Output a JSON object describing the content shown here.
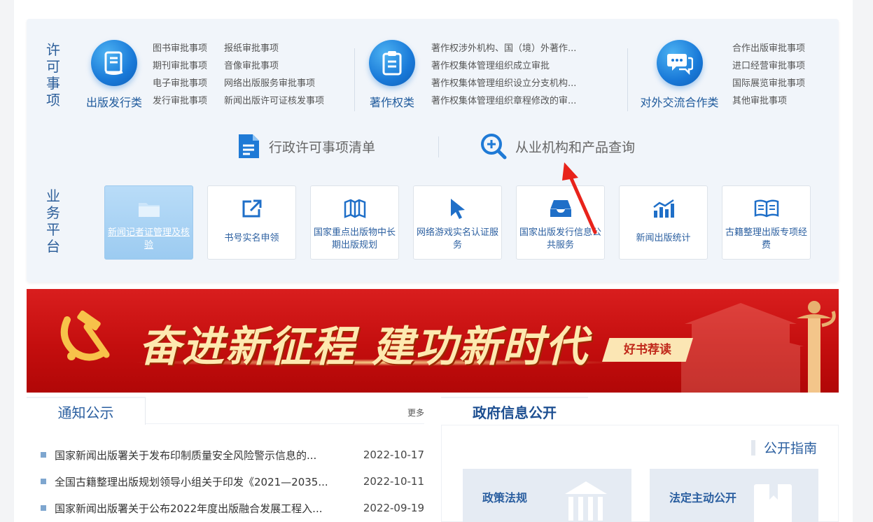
{
  "licensing": {
    "title_chars": [
      "许",
      "可",
      "事",
      "项"
    ],
    "categories": [
      {
        "label": "出版发行类",
        "icon": "book-icon",
        "items": [
          [
            "图书审批事项",
            "报纸审批事项"
          ],
          [
            "期刊审批事项",
            "音像审批事项"
          ],
          [
            "电子审批事项",
            "网络出版服务审批事项"
          ],
          [
            "发行审批事项",
            "新闻出版许可证核发事项"
          ]
        ]
      },
      {
        "label": "著作权类",
        "icon": "clipboard-icon",
        "items": [
          [
            "著作权涉外机构、国（境）外著作..."
          ],
          [
            "著作权集体管理组织成立审批"
          ],
          [
            "著作权集体管理组织设立分支机构..."
          ],
          [
            "著作权集体管理组织章程修改的审..."
          ]
        ]
      },
      {
        "label": "对外交流合作类",
        "icon": "chat-bubbles-icon",
        "items": [
          [
            "合作出版审批事项"
          ],
          [
            "进口经营审批事项"
          ],
          [
            "国际展览审批事项"
          ],
          [
            "其他审批事项"
          ]
        ]
      }
    ],
    "quick_links": [
      {
        "label": "行政许可事项清单",
        "icon": "document-list-icon"
      },
      {
        "label": "从业机构和产品查询",
        "icon": "magnifier-plus-icon"
      }
    ]
  },
  "platform": {
    "title_chars": [
      "业",
      "务",
      "平",
      "台"
    ],
    "tiles": [
      {
        "label": "新闻记者证管理及核验",
        "icon": "folder-icon",
        "active": true
      },
      {
        "label": "书号实名申领",
        "icon": "external-link-icon",
        "active": false
      },
      {
        "label": "国家重点出版物中长期出版规划",
        "icon": "map-icon",
        "active": false
      },
      {
        "label": "网络游戏实名认证服务",
        "icon": "cursor-icon",
        "active": false
      },
      {
        "label": "国家出版发行信息公共服务",
        "icon": "inbox-icon",
        "active": false
      },
      {
        "label": "新闻出版统计",
        "icon": "bar-chart-icon",
        "active": false
      },
      {
        "label": "古籍整理出版专项经费",
        "icon": "open-book-icon",
        "active": false
      }
    ]
  },
  "banner": {
    "slogan": "奋进新征程 建功新时代",
    "tag": "好书荐读"
  },
  "notices": {
    "title": "通知公示",
    "more": "更多",
    "items": [
      {
        "title": "国家新闻出版署关于发布印制质量安全风险警示信息的...",
        "date": "2022-10-17"
      },
      {
        "title": "全国古籍整理出版规划领导小组关于印发《2021—2035...",
        "date": "2022-10-11"
      },
      {
        "title": "国家新闻出版署关于公布2022年度出版融合发展工程入...",
        "date": "2022-09-19"
      }
    ]
  },
  "gov_info": {
    "title": "政府信息公开",
    "guide": "公开指南",
    "cards": [
      {
        "label": "政策法规",
        "icon": "building-icon"
      },
      {
        "label": "法定主动公开",
        "icon": "bookmark-icon"
      }
    ]
  },
  "colors": {
    "primary": "#2b5fa0",
    "icon_blue": "#1979d8",
    "banner_red": "#c40e0e",
    "banner_gold": "#fde9b0",
    "annotation_arrow": "#e8231b"
  }
}
